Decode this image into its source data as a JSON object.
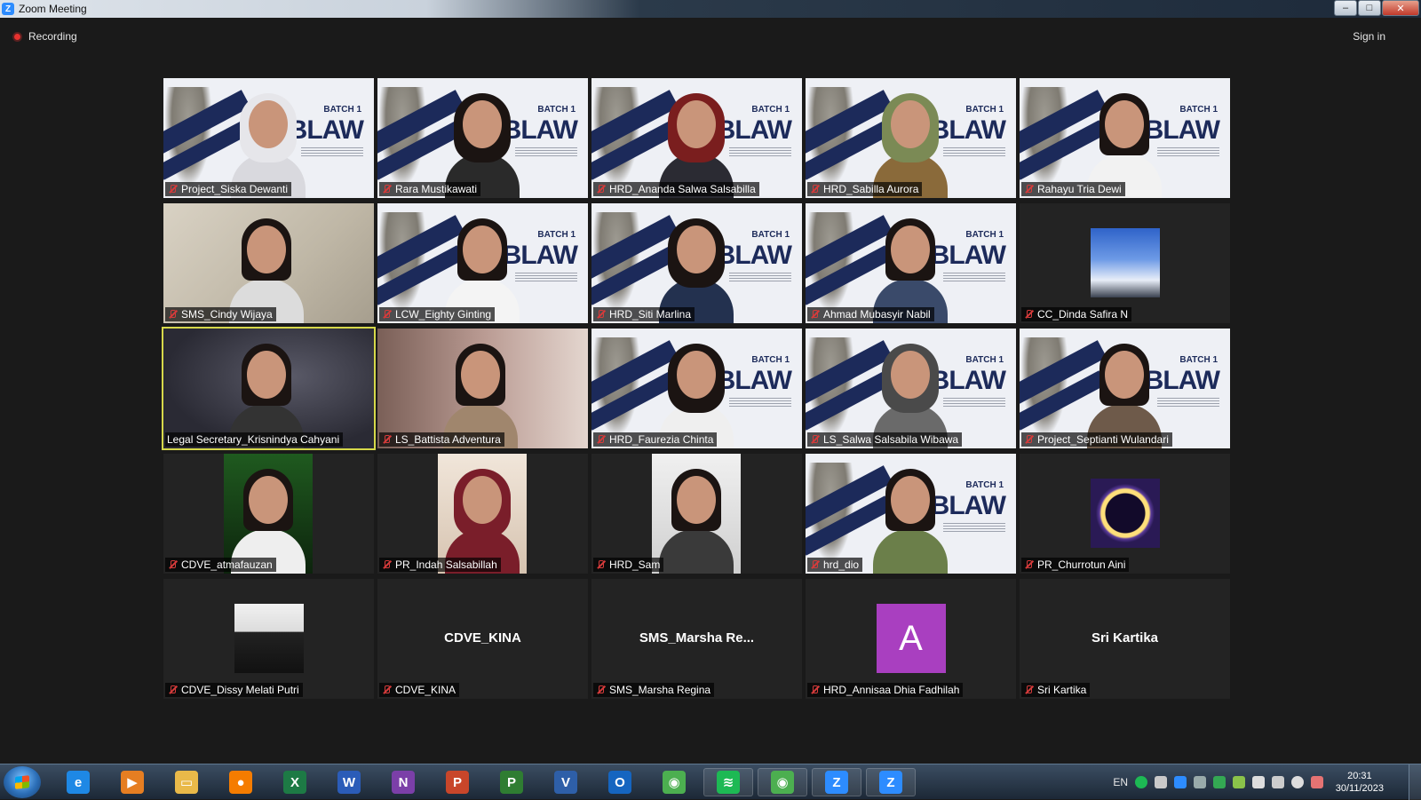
{
  "window": {
    "title": "Zoom Meeting",
    "buttons": [
      "–",
      "□",
      "✕"
    ]
  },
  "status": {
    "recording": "Recording",
    "sign_in": "Sign in"
  },
  "banner": {
    "batch": "BATCH 1",
    "text": "ABLAW"
  },
  "participants": [
    {
      "name": "Project_Siska Dewanti",
      "type": "banner"
    },
    {
      "name": "Rara Mustikawati",
      "type": "banner"
    },
    {
      "name": "HRD_Ananda Salwa Salsabilla",
      "type": "banner"
    },
    {
      "name": "HRD_Sabilla Aurora",
      "type": "banner"
    },
    {
      "name": "Rahayu Tria Dewi",
      "type": "banner"
    },
    {
      "name": "SMS_Cindy Wijaya",
      "type": "room"
    },
    {
      "name": "LCW_Eighty Ginting",
      "type": "banner"
    },
    {
      "name": "HRD_Siti Marlina",
      "type": "banner"
    },
    {
      "name": "Ahmad Mubasyir Nabil",
      "type": "banner"
    },
    {
      "name": "CC_Dinda Safira N",
      "type": "avatar"
    },
    {
      "name": "Legal Secretary_Krisnindya Cahyani",
      "type": "dark",
      "active": true
    },
    {
      "name": "LS_Battista Adventura",
      "type": "room2"
    },
    {
      "name": "HRD_Faurezia Chinta",
      "type": "banner"
    },
    {
      "name": "LS_Salwa Salsabila Wibawa",
      "type": "banner"
    },
    {
      "name": "Project_Septianti Wulandari",
      "type": "banner"
    },
    {
      "name": "CDVE_atmafauzan",
      "type": "thumb"
    },
    {
      "name": "PR_Indah Salsabillah",
      "type": "thumb"
    },
    {
      "name": "HRD_Sam",
      "type": "thumb"
    },
    {
      "name": "hrd_dio",
      "type": "banner"
    },
    {
      "name": "PR_Churrotun Aini",
      "type": "avatar"
    },
    {
      "name": "CDVE_Dissy Melati Putri",
      "type": "avatar"
    },
    {
      "name": "CDVE_KINA",
      "type": "text",
      "display": "CDVE_KINA"
    },
    {
      "name": "SMS_Marsha Regina",
      "type": "text",
      "display": "SMS_Marsha  Re..."
    },
    {
      "name": "HRD_Annisaa Dhia Fadhilah",
      "type": "letter",
      "display": "A"
    },
    {
      "name": "Sri Kartika",
      "type": "text",
      "display": "Sri Kartika"
    }
  ],
  "taskbar": {
    "icons": [
      {
        "name": "internet-explorer",
        "glyph": "e",
        "color": "#1e88e5"
      },
      {
        "name": "media-player",
        "glyph": "▶",
        "color": "#e67e22"
      },
      {
        "name": "file-explorer",
        "glyph": "▭",
        "color": "#e9b949"
      },
      {
        "name": "firefox",
        "glyph": "●",
        "color": "#f57c00"
      },
      {
        "name": "excel",
        "glyph": "X",
        "color": "#1d7a45"
      },
      {
        "name": "word",
        "glyph": "W",
        "color": "#2b5cb8"
      },
      {
        "name": "onenote",
        "glyph": "N",
        "color": "#7b3fa8"
      },
      {
        "name": "powerpoint",
        "glyph": "P",
        "color": "#c8462a"
      },
      {
        "name": "project",
        "glyph": "P",
        "color": "#2f7d32"
      },
      {
        "name": "visio",
        "glyph": "V",
        "color": "#2e5fa8"
      },
      {
        "name": "outlook",
        "glyph": "O",
        "color": "#1565c0"
      },
      {
        "name": "chrome",
        "glyph": "◉",
        "color": "#4caf50"
      },
      {
        "name": "spotify",
        "glyph": "≋",
        "color": "#1db954"
      },
      {
        "name": "chrome-active",
        "glyph": "◉",
        "color": "#4caf50"
      },
      {
        "name": "zoom-1",
        "glyph": "Z",
        "color": "#2d8cff"
      },
      {
        "name": "zoom-2",
        "glyph": "Z",
        "color": "#2d8cff"
      }
    ],
    "lang": "EN",
    "time": "20:31",
    "date": "30/11/2023"
  }
}
